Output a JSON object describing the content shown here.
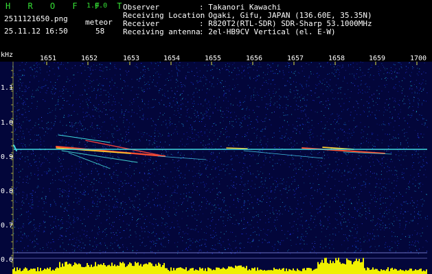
{
  "app": {
    "logo": "H R O F F T",
    "version": "1.0.0",
    "filename": "2511121650.png",
    "datetime": "25.11.12 16:50",
    "meteor_label": "meteor",
    "meteor_count": "58"
  },
  "info": {
    "observer_label": "Observer",
    "observer_value": ": Takanori Kawachi",
    "location_label": "Receiving Location",
    "location_value": ": Ogaki, Gifu, JAPAN (136.60E, 35.35N)",
    "receiver_label": "Receiver",
    "receiver_value": ": R820T2(RTL-SDR) SDR-Sharp 53.1000MHz",
    "antenna_label": "Receiving antenna",
    "antenna_value": ": 2el-HB9CV Vertical (el. E-W)"
  },
  "axes": {
    "y_unit": "kHz",
    "x_ticks": [
      "1651",
      "1652",
      "1653",
      "1654",
      "1655",
      "1656",
      "1657",
      "1658",
      "1659",
      "1700"
    ],
    "y_ticks": [
      "1.1",
      "1.0",
      "0.9",
      "0.8",
      "0.7",
      "0.6"
    ]
  },
  "colors": {
    "background": "#03063a",
    "header_green": "#35e035",
    "carrier_line": "#40d8e0",
    "tick_color": "#e8e840",
    "level_bar": "#f0f000"
  }
}
